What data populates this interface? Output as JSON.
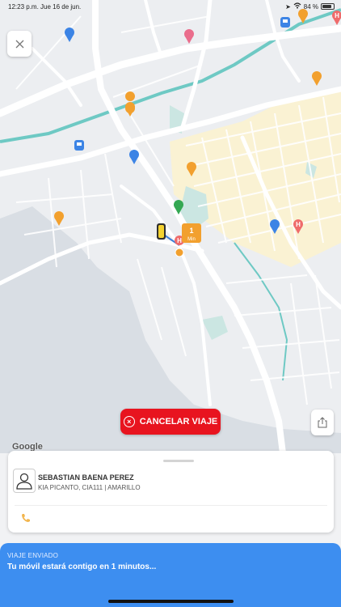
{
  "status_bar": {
    "time": "12:23 p.m.",
    "date": "Jue 16 de jun.",
    "battery": "84 %",
    "battery_level": 0.84
  },
  "map": {
    "google_label": "Google",
    "eta_marker": {
      "value": "1",
      "unit": "Min"
    },
    "colors": {
      "land": "#eceef1",
      "road": "#ffffff",
      "water": "#d6dce2",
      "river": "#6ec9c4",
      "urban": "#faf2d3",
      "park": "#cbe6e2",
      "route": "#3f7fd8",
      "pin_food": "#f2a02e",
      "pin_transit": "#3c84e5",
      "pin_health": "#ef6b6b",
      "pin_shop": "#ea6d8c",
      "pin_park": "#34a853"
    },
    "icons": [
      "close-icon",
      "share-icon",
      "car-icon",
      "hospital-icon",
      "restaurant-icon",
      "bus-icon",
      "bar-icon"
    ]
  },
  "actions": {
    "cancel_label": "CANCELAR VIAJE"
  },
  "driver": {
    "name": "SEBASTIAN BAENA PEREZ",
    "vehicle": "KIA PICANTO, CIA111 | AMARILLO"
  },
  "trip": {
    "status": "VIAJE ENVIADO",
    "message": "Tu móvil estará contigo en 1 minutos..."
  },
  "theme": {
    "cancel_color": "#e8141f",
    "banner_color": "#3d8ef0"
  }
}
